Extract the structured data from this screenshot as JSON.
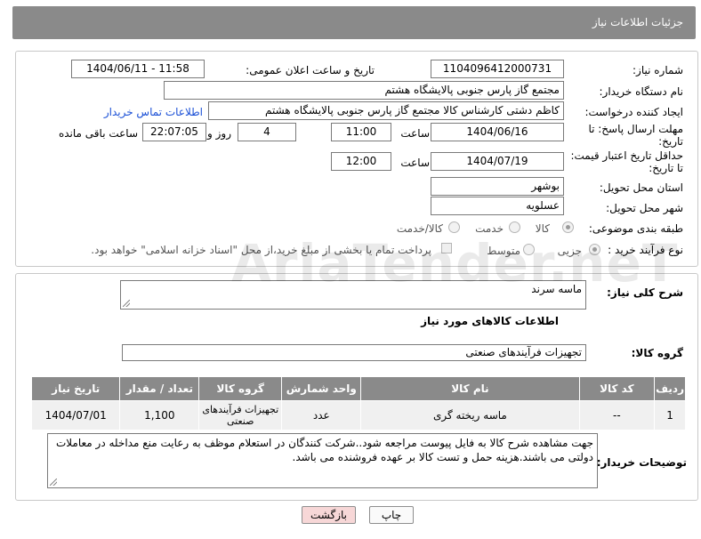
{
  "header": {
    "title": "جزئیات اطلاعات نیاز"
  },
  "form": {
    "need_number": {
      "label": "شماره نیاز:",
      "value": "1104096412000731"
    },
    "announce_datetime": {
      "label": "تاریخ و ساعت اعلان عمومی:",
      "value": "1404/06/11 - 11:58"
    },
    "buyer_org": {
      "label": "نام دستگاه خریدار:",
      "value": "مجتمع گاز پارس جنوبی  پالایشگاه هشتم"
    },
    "requester": {
      "label": "ایجاد کننده درخواست:",
      "value": "کاظم دشتی کارشناس کالا مجتمع گاز پارس جنوبی  پالایشگاه هشتم",
      "contact_link": "اطلاعات تماس خریدار"
    },
    "reply_deadline": {
      "label_line1": "مهلت ارسال پاسخ: تا",
      "label_line2": "تاریخ:",
      "date": "1404/06/16",
      "time_label": "ساعت",
      "time": "11:00",
      "days": "4",
      "days_label": "روز و",
      "remaining": "22:07:05",
      "remaining_label": "ساعت باقی مانده"
    },
    "price_validity": {
      "label_line1": "حداقل تاریخ اعتبار قیمت:",
      "label_line2": "تا تاریخ:",
      "date": "1404/07/19",
      "time_label": "ساعت",
      "time": "12:00"
    },
    "delivery_province": {
      "label": "استان محل تحویل:",
      "value": "بوشهر"
    },
    "delivery_city": {
      "label": "شهر محل تحویل:",
      "value": "عسلویه"
    },
    "subject_category": {
      "label": "طبقه بندی موضوعی:",
      "options": [
        "کالا",
        "خدمت",
        "کالا/خدمت"
      ],
      "selected": "کالا"
    },
    "purchase_process": {
      "label": "نوع فرآیند خرید :",
      "options": [
        "جزیی",
        "متوسط"
      ],
      "selected": "جزیی",
      "treasury_note": "پرداخت تمام یا بخشی از مبلغ خرید،از محل \"اسناد خزانه اسلامی\" خواهد بود."
    }
  },
  "details": {
    "description_label": "شرح کلی نیاز:",
    "description_value": "ماسه سرند",
    "goods_info_title": "اطلاعات کالاهای مورد نیاز",
    "goods_group_label": "گروه کالا:",
    "goods_group_value": "تجهیزات فرآیندهای صنعتی",
    "table": {
      "headers": [
        "ردیف",
        "کد کالا",
        "نام کالا",
        "واحد شمارش",
        "گروه کالا",
        "تعداد / مقدار",
        "تاریخ نیاز"
      ],
      "rows": [
        [
          "1",
          "--",
          "ماسه ریخته گری",
          "عدد",
          "تجهیزات فرآیندهای صنعتی",
          "1,100",
          "1404/07/01"
        ]
      ]
    },
    "buyer_notes_label": "توضیحات خریدار:",
    "buyer_notes_value": "جهت مشاهده شرح کالا به فایل پیوست مراجعه شود..شرکت کنندگان در استعلام موظف به رعایت منع مداخله در معاملات دولتی می باشند.هزینه حمل و تست کالا بر عهده فروشنده می باشد."
  },
  "buttons": {
    "print": "چاپ",
    "back": "بازگشت"
  },
  "colors": {
    "header_bg": "#8a8a8a",
    "link": "#1a4fd6",
    "back_button_bg": "#f7d7d7"
  },
  "watermark": "AriaTender.neT"
}
